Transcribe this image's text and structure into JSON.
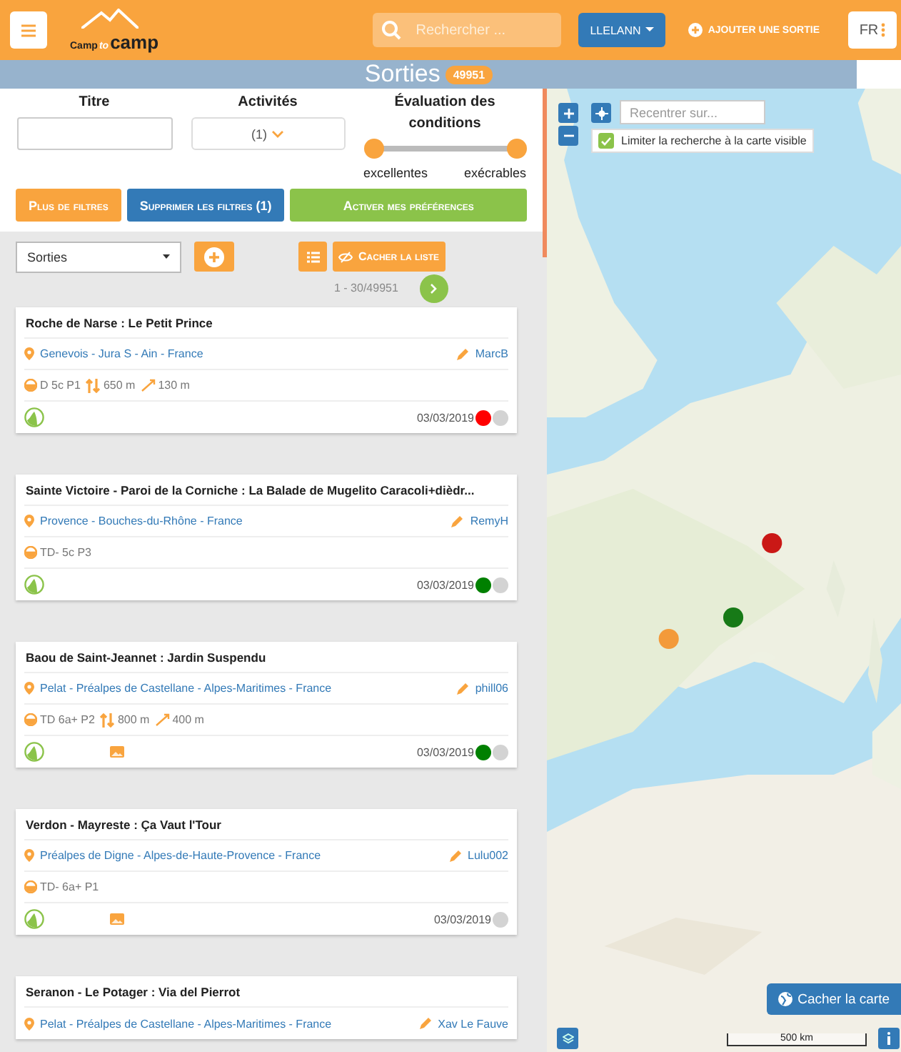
{
  "header": {
    "logo": [
      "Camp",
      "to",
      "camp"
    ],
    "search": {
      "placeholder": "Rechercher ..."
    },
    "user_button": "LLELANN",
    "add_button": "AJOUTER UNE SORTIE",
    "language": "FR"
  },
  "title_bar": {
    "title": "Sorties",
    "count": "49951"
  },
  "filters": {
    "title_label": "Titre",
    "activities_label": "Activités",
    "activities_value": "(1)",
    "conditions_label": "Évaluation des conditions",
    "range": [
      {
        "level": 0
      },
      {
        "level": 1
      }
    ],
    "range_labels": [
      "excellentes",
      "exécrables"
    ],
    "buttons": [
      {
        "label": "Plus de filtres",
        "kind": "orange"
      },
      {
        "label": "Supprimer les filtres (1)",
        "kind": "blue"
      },
      {
        "label": "Activer mes préférences",
        "kind": "green"
      }
    ]
  },
  "list_toolbar": {
    "type_select": "Sorties",
    "hide_list": "Cacher la liste",
    "pagination": "1 - 30/49951"
  },
  "outings": [
    {
      "title": "Roche de Narse : Le Petit Prince",
      "location": "Genevois - Jura S - Ain - France",
      "author": "MarcB",
      "ratings": [
        {
          "kind": "grade",
          "text": "D 5c P1"
        },
        {
          "kind": "height",
          "text": "650 m"
        },
        {
          "kind": "elevation",
          "text": "130 m"
        }
      ],
      "has_images": false,
      "date": "03/03/2019",
      "color": "#ff0000"
    },
    {
      "title": "Sainte Victoire - Paroi de la Corniche : La Balade de Mugelito Caracoli+dièdr...",
      "location": "Provence - Bouches-du-Rhône - France",
      "author": "RemyH",
      "ratings": [
        {
          "kind": "grade",
          "text": "TD- 5c P3"
        }
      ],
      "has_images": false,
      "date": "03/03/2019",
      "color": "#008000"
    },
    {
      "title": "Baou de Saint-Jeannet : Jardin Suspendu",
      "location": "Pelat - Préalpes de Castellane - Alpes-Maritimes - France",
      "author": "phill06",
      "ratings": [
        {
          "kind": "grade",
          "text": "TD 6a+ P2"
        },
        {
          "kind": "height",
          "text": "800 m"
        },
        {
          "kind": "elevation",
          "text": "400 m"
        }
      ],
      "has_images": true,
      "date": "03/03/2019",
      "color": "#008000"
    },
    {
      "title": "Verdon - Mayreste : Ça Vaut l'Tour",
      "location": "Préalpes de Digne - Alpes-de-Haute-Provence - France",
      "author": "Lulu002",
      "ratings": [
        {
          "kind": "grade",
          "text": "TD- 6a+ P1"
        }
      ],
      "has_images": true,
      "date": "03/03/2019"
    },
    {
      "title": "Seranon - Le Potager : Via del Pierrot",
      "location": "Pelat - Préalpes de Castellane - Alpes-Maritimes - France",
      "author": "Xav Le Fauve"
    }
  ],
  "map": {
    "kind": "picture",
    "recenter_placeholder": "Recentrer sur...",
    "limit_search": {
      "label": "Limiter la recherche à la carte visible",
      "checked": true
    },
    "hide_map": "Cacher la carte",
    "scale": "500 km"
  }
}
